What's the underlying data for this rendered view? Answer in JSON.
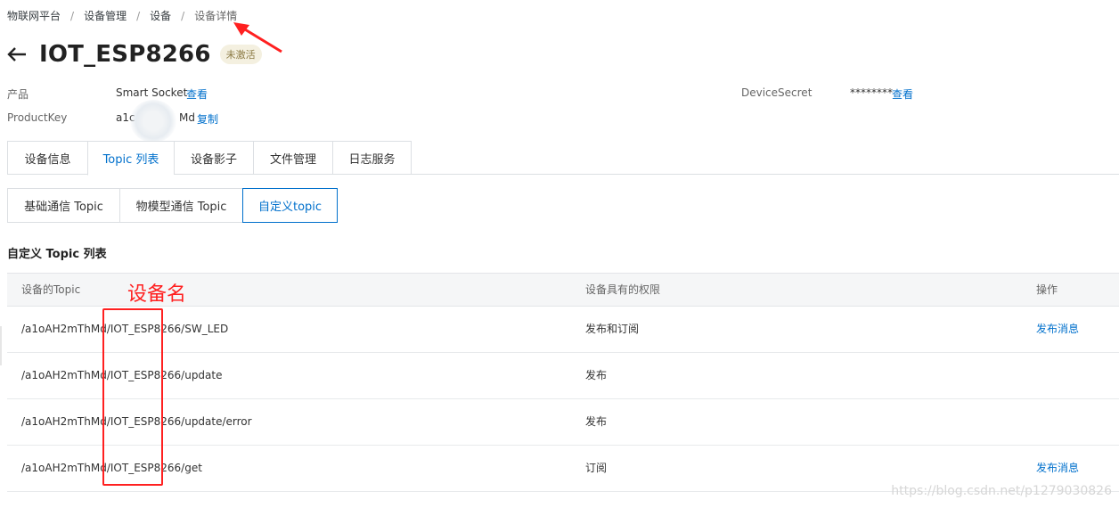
{
  "breadcrumb": {
    "items": [
      "物联网平台",
      "设备管理",
      "设备",
      "设备详情"
    ],
    "separator": "/"
  },
  "header": {
    "back_icon": "arrow-left-icon",
    "title": "IOT_ESP8266",
    "status": "未激活"
  },
  "meta": {
    "product_label": "产品",
    "product_value": "Smart Socket",
    "product_link": "查看",
    "productkey_label": "ProductKey",
    "productkey_value": "a1c",
    "productkey_value_tail": "Md",
    "productkey_link": "复制",
    "secret_label": "DeviceSecret",
    "secret_value": "********",
    "secret_link": "查看"
  },
  "tabs": [
    "设备信息",
    "Topic 列表",
    "设备影子",
    "文件管理",
    "日志服务"
  ],
  "active_tab": "Topic 列表",
  "subtabs": [
    "基础通信 Topic",
    "物模型通信 Topic",
    "自定义topic"
  ],
  "active_subtab": "自定义topic",
  "section_title": "自定义 Topic 列表",
  "table": {
    "columns": [
      "设备的Topic",
      "设备具有的权限",
      "操作"
    ],
    "rows": [
      {
        "topic": "/a1oAH2mThMd/IOT_ESP8266/SW_LED",
        "permission": "发布和订阅",
        "action": "发布消息"
      },
      {
        "topic": "/a1oAH2mThMd/IOT_ESP8266/update",
        "permission": "发布",
        "action": ""
      },
      {
        "topic": "/a1oAH2mThMd/IOT_ESP8266/update/error",
        "permission": "发布",
        "action": ""
      },
      {
        "topic": "/a1oAH2mThMd/IOT_ESP8266/get",
        "permission": "订阅",
        "action": "发布消息"
      }
    ]
  },
  "annotation": {
    "label": "设备名",
    "color": "#ff2020"
  },
  "watermark": "https://blog.csdn.net/p1279030826",
  "colors": {
    "link": "#0070cc",
    "badge_bg": "#f4f0e0",
    "badge_text": "#8b7a44"
  }
}
